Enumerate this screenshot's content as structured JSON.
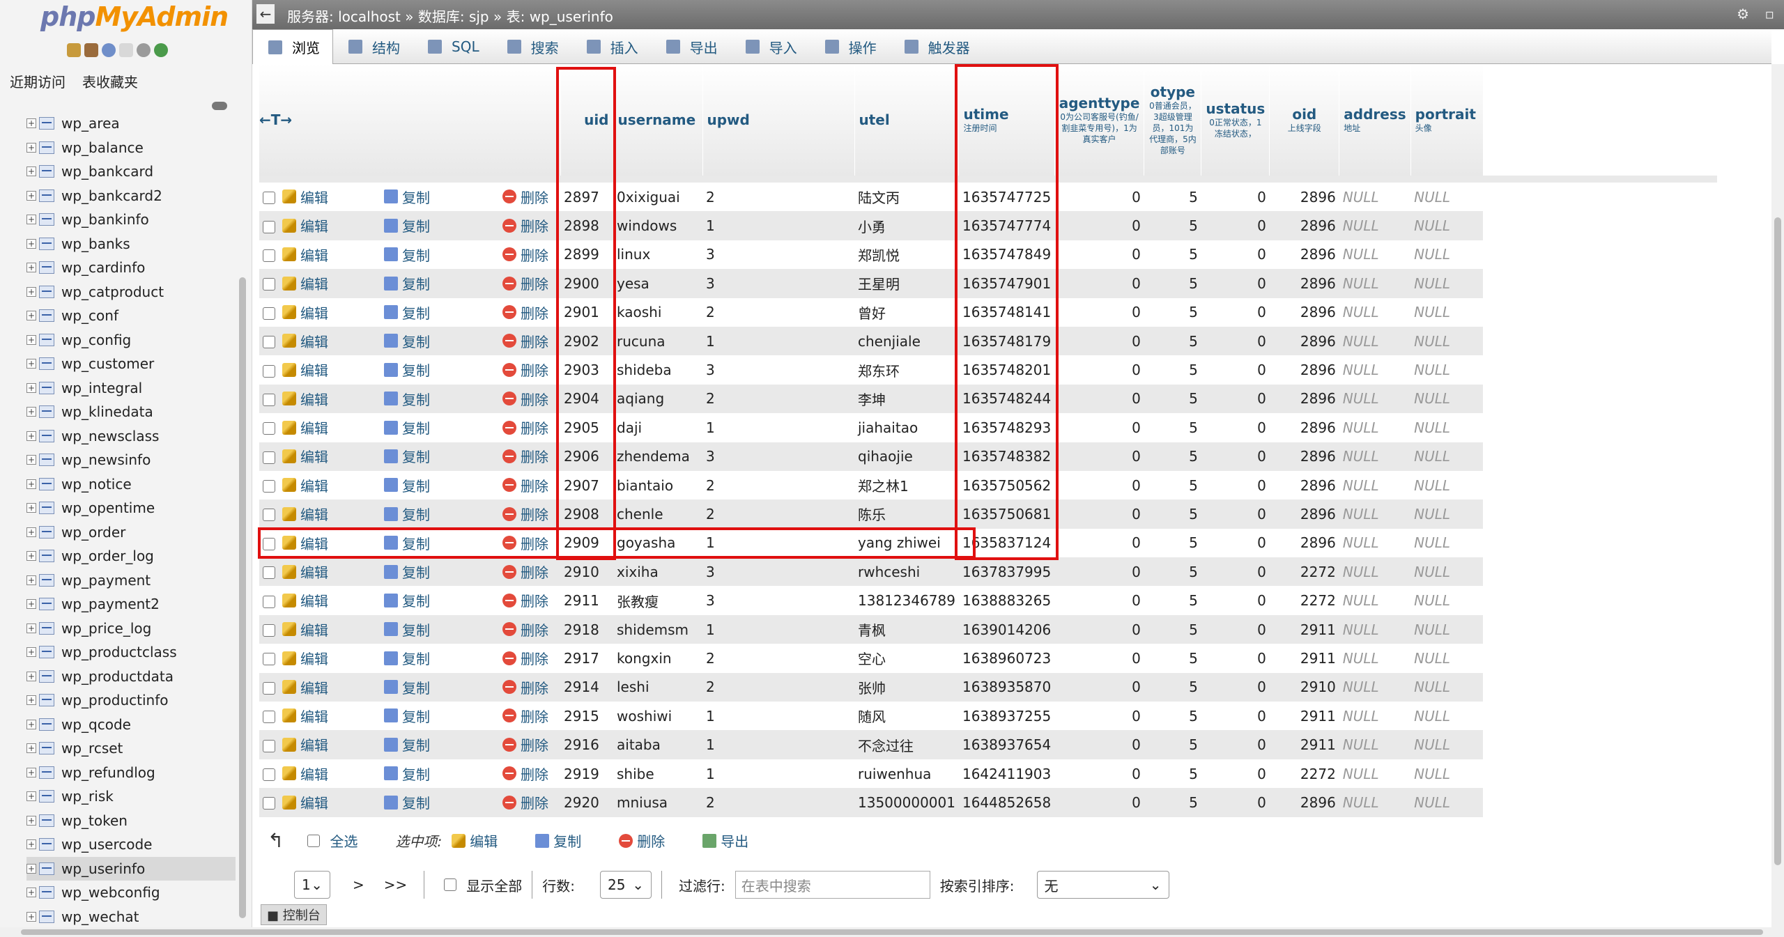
{
  "app": {
    "logo_a": "php",
    "logo_b": "MyAdmin"
  },
  "sidebar": {
    "tabs": [
      "近期访问",
      "表收藏夹"
    ],
    "tables": [
      "wp_area",
      "wp_balance",
      "wp_bankcard",
      "wp_bankcard2",
      "wp_bankinfo",
      "wp_banks",
      "wp_cardinfo",
      "wp_catproduct",
      "wp_conf",
      "wp_config",
      "wp_customer",
      "wp_integral",
      "wp_klinedata",
      "wp_newsclass",
      "wp_newsinfo",
      "wp_notice",
      "wp_opentime",
      "wp_order",
      "wp_order_log",
      "wp_payment",
      "wp_payment2",
      "wp_price_log",
      "wp_productclass",
      "wp_productdata",
      "wp_productinfo",
      "wp_qcode",
      "wp_rcset",
      "wp_refundlog",
      "wp_risk",
      "wp_token",
      "wp_usercode",
      "wp_userinfo",
      "wp_webconfig",
      "wp_wechat"
    ],
    "selected": "wp_userinfo"
  },
  "breadcrumb": {
    "server": "服务器: localhost",
    "sep1": "»",
    "database": "数据库: sjp",
    "sep2": "»",
    "table": "表: wp_userinfo"
  },
  "tabs": [
    "浏览",
    "结构",
    "SQL",
    "搜索",
    "插入",
    "导出",
    "导入",
    "操作",
    "触发器"
  ],
  "table": {
    "arrows": "←T→",
    "headers": [
      {
        "name": "uid",
        "sub": ""
      },
      {
        "name": "username",
        "sub": ""
      },
      {
        "name": "upwd",
        "sub": ""
      },
      {
        "name": "utel",
        "sub": ""
      },
      {
        "name": "utime",
        "sub": "注册时间"
      },
      {
        "name": "agenttype",
        "sub": "0为公司客服号(钓鱼/割韭菜专用号)，1为真实客户"
      },
      {
        "name": "otype",
        "sub": "0普通会员，3超级管理员，101为代理商，5内部账号"
      },
      {
        "name": "ustatus",
        "sub": "0正常状态，1冻结状态，"
      },
      {
        "name": "oid",
        "sub": "上线字段"
      },
      {
        "name": "address",
        "sub": "地址"
      },
      {
        "name": "portrait",
        "sub": "头像"
      }
    ],
    "actions": {
      "edit": "编辑",
      "copy": "复制",
      "delete": "删除"
    },
    "rows": [
      [
        "2897",
        "0xixiguai",
        "2",
        "陆文丙",
        "1635747725",
        "0",
        "5",
        "0",
        "2896",
        "NULL",
        "NULL"
      ],
      [
        "2898",
        "windows",
        "1",
        "小勇",
        "1635747774",
        "0",
        "5",
        "0",
        "2896",
        "NULL",
        "NULL"
      ],
      [
        "2899",
        "linux",
        "3",
        "郑凯悦",
        "1635747849",
        "0",
        "5",
        "0",
        "2896",
        "NULL",
        "NULL"
      ],
      [
        "2900",
        "yesa",
        "3",
        "王星明",
        "1635747901",
        "0",
        "5",
        "0",
        "2896",
        "NULL",
        "NULL"
      ],
      [
        "2901",
        "kaoshi",
        "2",
        "曾好",
        "1635748141",
        "0",
        "5",
        "0",
        "2896",
        "NULL",
        "NULL"
      ],
      [
        "2902",
        "rucuna",
        "1",
        "chenjiale",
        "1635748179",
        "0",
        "5",
        "0",
        "2896",
        "NULL",
        "NULL"
      ],
      [
        "2903",
        "shideba",
        "3",
        "郑东环",
        "1635748201",
        "0",
        "5",
        "0",
        "2896",
        "NULL",
        "NULL"
      ],
      [
        "2904",
        "aqiang",
        "2",
        "李坤",
        "1635748244",
        "0",
        "5",
        "0",
        "2896",
        "NULL",
        "NULL"
      ],
      [
        "2905",
        "daji",
        "1",
        "jiahaitao",
        "1635748293",
        "0",
        "5",
        "0",
        "2896",
        "NULL",
        "NULL"
      ],
      [
        "2906",
        "zhendema",
        "3",
        "qihaojie",
        "1635748382",
        "0",
        "5",
        "0",
        "2896",
        "NULL",
        "NULL"
      ],
      [
        "2907",
        "biantaio",
        "2",
        "郑之林1",
        "1635750562",
        "0",
        "5",
        "0",
        "2896",
        "NULL",
        "NULL"
      ],
      [
        "2908",
        "chenle",
        "2",
        "陈乐",
        "1635750681",
        "0",
        "5",
        "0",
        "2896",
        "NULL",
        "NULL"
      ],
      [
        "2909",
        "goyasha",
        "1",
        "yang zhiwei",
        "1635837124",
        "0",
        "5",
        "0",
        "2896",
        "NULL",
        "NULL"
      ],
      [
        "2910",
        "xixiha",
        "3",
        "rwhceshi",
        "1637837995",
        "0",
        "5",
        "0",
        "2272",
        "NULL",
        "NULL"
      ],
      [
        "2911",
        "张教瘦",
        "3",
        "13812346789",
        "1638883265",
        "0",
        "5",
        "0",
        "2272",
        "NULL",
        "NULL"
      ],
      [
        "2918",
        "shidemsm",
        "1",
        "青枫",
        "1639014206",
        "0",
        "5",
        "0",
        "2911",
        "NULL",
        "NULL"
      ],
      [
        "2917",
        "kongxin",
        "2",
        "空心",
        "1638960723",
        "0",
        "5",
        "0",
        "2911",
        "NULL",
        "NULL"
      ],
      [
        "2914",
        "leshi",
        "2",
        "张帅",
        "1638935870",
        "0",
        "5",
        "0",
        "2910",
        "NULL",
        "NULL"
      ],
      [
        "2915",
        "woshiwi",
        "1",
        "随风",
        "1638937255",
        "0",
        "5",
        "0",
        "2911",
        "NULL",
        "NULL"
      ],
      [
        "2916",
        "aitaba",
        "1",
        "不念过往",
        "1638937654",
        "0",
        "5",
        "0",
        "2911",
        "NULL",
        "NULL"
      ],
      [
        "2919",
        "shibe",
        "1",
        "ruiwenhua",
        "1642411903",
        "0",
        "5",
        "0",
        "2272",
        "NULL",
        "NULL"
      ],
      [
        "2920",
        "mniusa",
        "2",
        "13500000001",
        "1644852658",
        "0",
        "5",
        "0",
        "2896",
        "NULL",
        "NULL"
      ]
    ]
  },
  "bulk": {
    "select_all": "全选",
    "with_selected": "选中项:",
    "edit": "编辑",
    "copy": "复制",
    "delete": "删除",
    "export": "导出"
  },
  "pager": {
    "page": "1",
    "next": ">",
    "last": ">>",
    "show_all": "显示全部",
    "rows_label": "行数:",
    "rows_value": "25",
    "filter_label": "过滤行:",
    "filter_placeholder": "在表中搜索",
    "sort_label": "按索引排序:",
    "sort_value": "无"
  },
  "console": "控制台"
}
